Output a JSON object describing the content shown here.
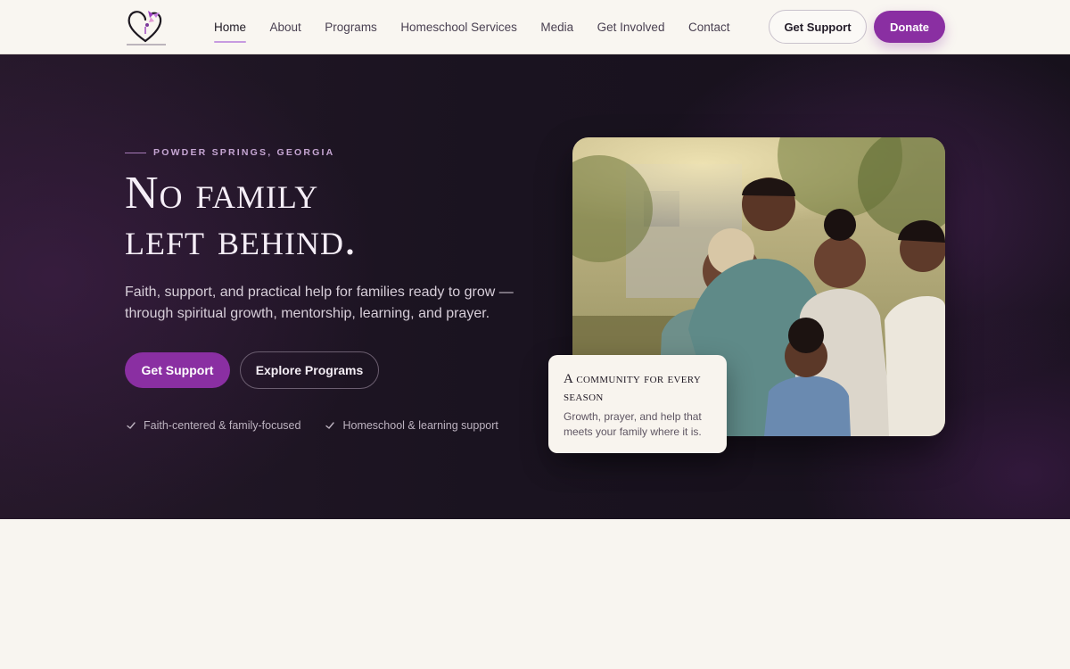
{
  "header": {
    "nav": [
      {
        "label": "Home",
        "active": true
      },
      {
        "label": "About"
      },
      {
        "label": "Programs"
      },
      {
        "label": "Homeschool Services"
      },
      {
        "label": "Media"
      },
      {
        "label": "Get Involved"
      },
      {
        "label": "Contact"
      }
    ],
    "get_support_label": "Get Support",
    "donate_label": "Donate"
  },
  "hero": {
    "eyebrow": "POWDER SPRINGS, GEORGIA",
    "title_line1": "No family",
    "title_line2": "left behind.",
    "subtitle": "Faith, support, and practical help for families ready to grow — through spiritual growth, mentorship, learning, and prayer.",
    "primary_cta": "Get Support",
    "secondary_cta": "Explore Programs",
    "checks": [
      "Faith-centered & family-focused",
      "Homeschool & learning support"
    ],
    "card_title": "A community for every season",
    "card_body": "Growth, prayer, and help that meets your family where it is."
  },
  "colors": {
    "brand": "#8a2fa2",
    "hero_bg": "#1a1320",
    "page_bg": "#f8f5f0"
  },
  "icons": [
    "logo-heart-icon",
    "check-icon"
  ]
}
